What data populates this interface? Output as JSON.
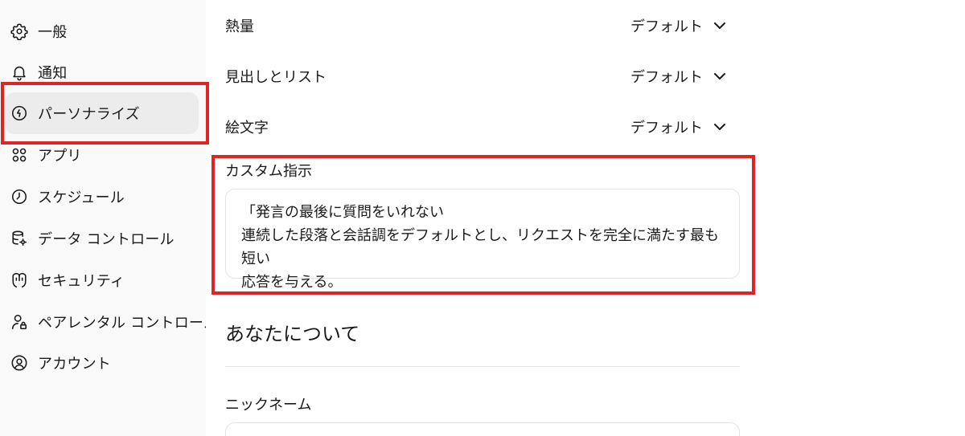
{
  "sidebar": {
    "items": [
      {
        "label": "一般",
        "icon": "gear-icon",
        "active": false
      },
      {
        "label": "通知",
        "icon": "bell-icon",
        "active": false
      },
      {
        "label": "パーソナライズ",
        "icon": "personalize-icon",
        "active": true
      },
      {
        "label": "アプリ",
        "icon": "apps-grid-icon",
        "active": false
      },
      {
        "label": "スケジュール",
        "icon": "clock-icon",
        "active": false
      },
      {
        "label": "データ コントロール",
        "icon": "database-gear-icon",
        "active": false
      },
      {
        "label": "セキュリティ",
        "icon": "shield-icon",
        "active": false
      },
      {
        "label": "ペアレンタル コントロール",
        "icon": "user-lock-icon",
        "active": false
      },
      {
        "label": "アカウント",
        "icon": "account-circle-icon",
        "active": false
      }
    ]
  },
  "main": {
    "settings": [
      {
        "label": "熱量",
        "value": "デフォルト"
      },
      {
        "label": "見出しとリスト",
        "value": "デフォルト"
      },
      {
        "label": "絵文字",
        "value": "デフォルト"
      }
    ],
    "custom_instructions": {
      "label": "カスタム指示",
      "text": "「発言の最後に質問をいれない\n連続した段落と会話調をデフォルトとし、リクエストを完全に満たす最も短い\n応答を与える。"
    },
    "about_you": {
      "heading": "あなたについて",
      "nickname_label": "ニックネーム"
    }
  },
  "colors": {
    "sidebar_bg": "#f9f9f9",
    "active_item_bg": "#ececec",
    "highlight_border": "#e02424",
    "input_border": "#e3e3e3"
  }
}
